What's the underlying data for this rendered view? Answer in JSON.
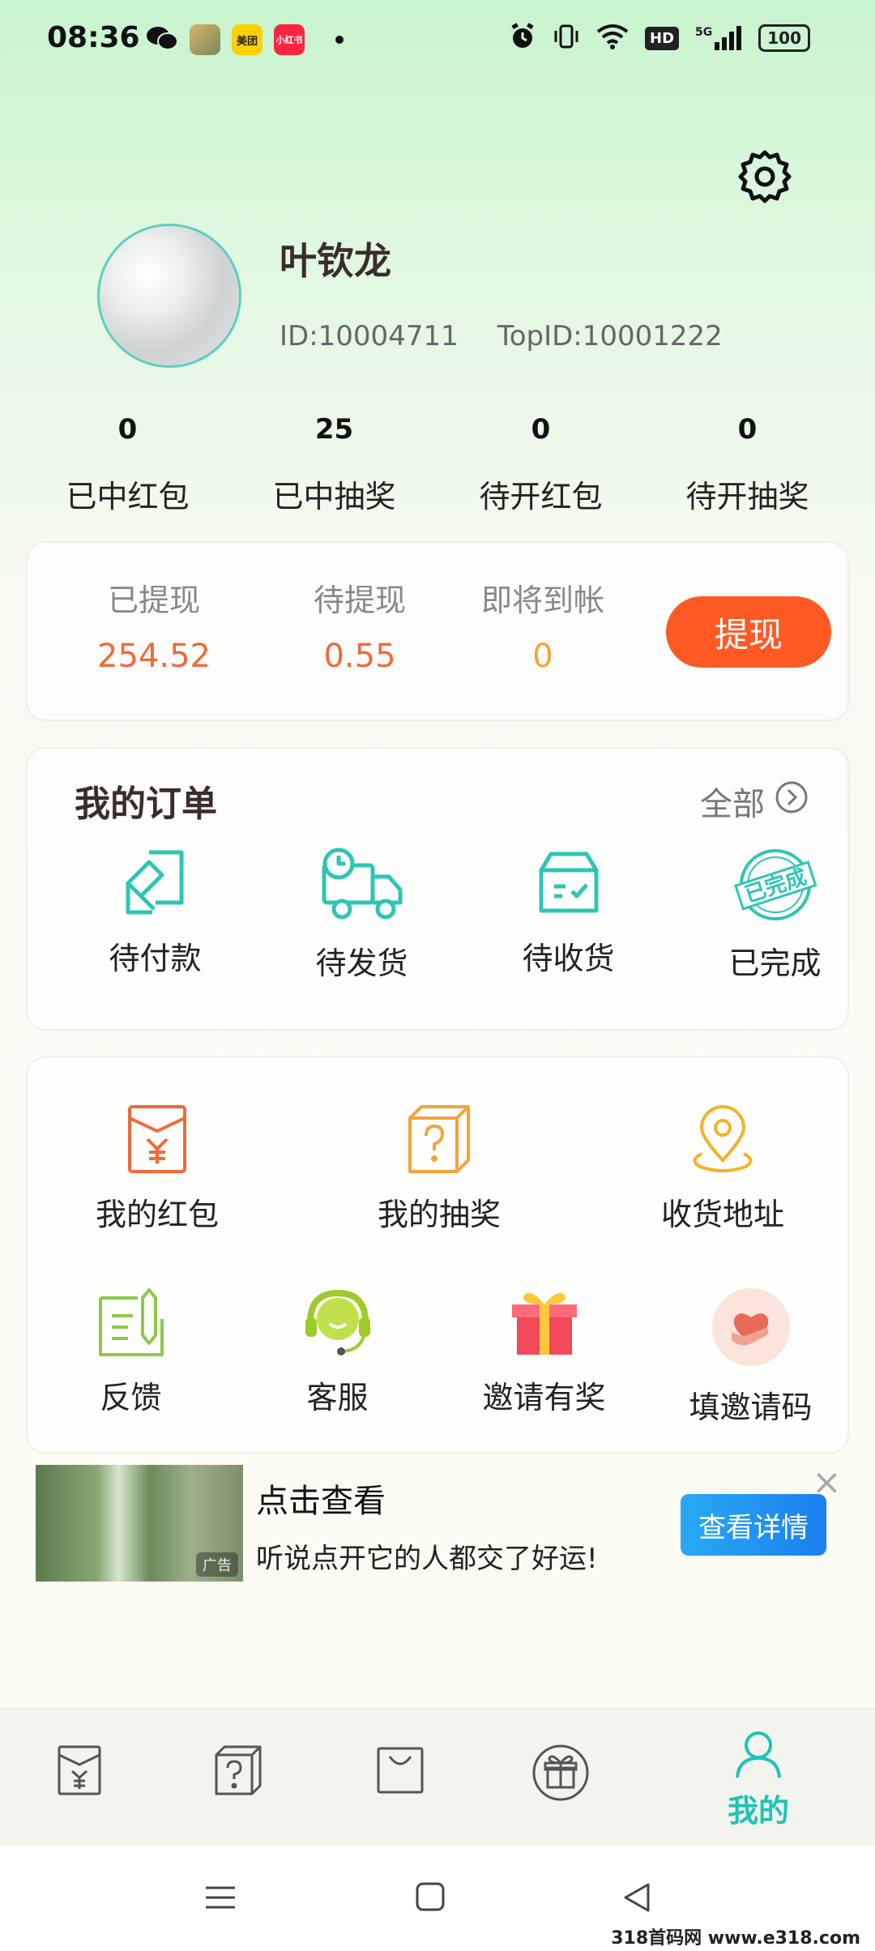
{
  "status_bar": {
    "time": "08:36",
    "app_meituan": "美团",
    "app_xiaohongshu": "小红书",
    "hd": "HD",
    "network": "5G",
    "battery": "100"
  },
  "profile": {
    "name": "叶钦龙",
    "id": "ID:10004711",
    "top_id": "TopID:10001222"
  },
  "stats": [
    {
      "value": "0",
      "label": "已中红包"
    },
    {
      "value": "25",
      "label": "已中抽奖"
    },
    {
      "value": "0",
      "label": "待开红包"
    },
    {
      "value": "0",
      "label": "待开抽奖"
    }
  ],
  "wallet": {
    "withdrawn_label": "已提现",
    "withdrawn_value": "254.52",
    "pending_label": "待提现",
    "pending_value": "0.55",
    "arriving_label": "即将到帐",
    "arriving_value": "0",
    "withdraw_button": "提现"
  },
  "orders": {
    "title": "我的订单",
    "all_label": "全部",
    "items": [
      {
        "label": "待付款",
        "icon": "payment-icon"
      },
      {
        "label": "待发货",
        "icon": "truck-icon"
      },
      {
        "label": "待收货",
        "icon": "box-icon"
      },
      {
        "label": "已完成",
        "icon": "completed-stamp-icon",
        "stamp_text": "已完成"
      }
    ]
  },
  "tools": [
    {
      "label": "我的红包",
      "icon": "red-envelope-icon"
    },
    {
      "label": "我的抽奖",
      "icon": "mystery-box-icon"
    },
    {
      "label": "收货地址",
      "icon": "location-pin-icon"
    },
    {
      "label": "反馈",
      "icon": "feedback-icon"
    },
    {
      "label": "客服",
      "icon": "customer-service-icon"
    },
    {
      "label": "邀请有奖",
      "icon": "gift-icon"
    },
    {
      "label": "填邀请码",
      "icon": "heart-hand-icon"
    }
  ],
  "ad": {
    "title": "点击查看",
    "subtitle": "听说点开它的人都交了好运!",
    "button": "查看详情",
    "badge": "广告"
  },
  "tabbar": {
    "active_label": "我的"
  },
  "watermark": "318首码网 www.e318.com",
  "colors": {
    "accent": "#1ec4b6",
    "withdraw_button": "#ff5a24",
    "amount": "#f06a3a",
    "arriving": "#f4a33a"
  }
}
